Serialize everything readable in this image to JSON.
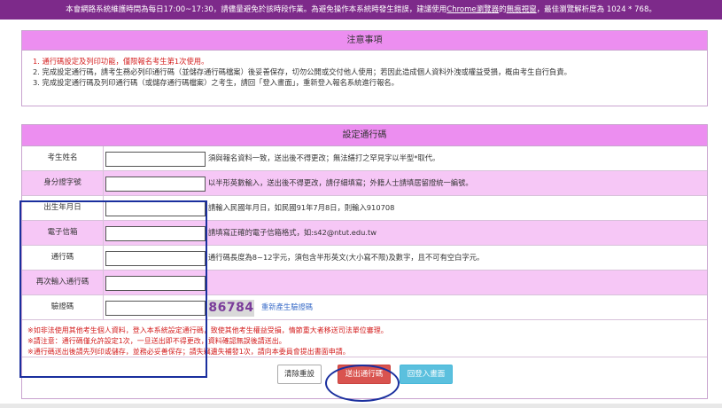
{
  "banner": {
    "text_before": "本會網路系統維護時間為每日17:00~17:30，請儘量避免於該時段作業。為避免操作本系統時發生錯誤，建議使用",
    "browser_link": "Chrome瀏覽器",
    "text_mid": "的",
    "incognito_link": "無痕視窗",
    "text_after": "，最佳瀏覽解析度為 1024 * 768。"
  },
  "notice": {
    "title": "注意事項",
    "item1": "1. 通行碼設定及列印功能，僅限報名考生第1次使用。",
    "item2": "2. 完成設定通行碼，請考生務必列印通行碼（並儲存通行碼檔案）後妥善保存，切勿公開或交付他人使用；若因此造成個人資料外洩或權益受損，概由考生自行負責。",
    "item3": "3. 完成設定通行碼及列印通行碼（或儲存通行碼檔案）之考生，請回「登入畫面」，重新登入報名系統進行報名。"
  },
  "form": {
    "title": "設定通行碼",
    "fields": {
      "name": {
        "label": "考生姓名",
        "value": "",
        "hint": "須與報名資料一致，送出後不得更改；無法繕打之罕見字以半型*取代。"
      },
      "id": {
        "label": "身分證字號",
        "value": "",
        "hint": "以半形英數輸入，送出後不得更改，請仔細填寫；外籍人士請填居留證統一編號。"
      },
      "birth": {
        "label": "出生年月日",
        "value": "",
        "hint": "請輸入民國年月日，如民國91年7月8日，則輸入910708"
      },
      "email": {
        "label": "電子信箱",
        "value": "",
        "hint": "請填寫正確的電子信箱格式，如:s42@ntut.edu.tw"
      },
      "pass": {
        "label": "通行碼",
        "value": "",
        "hint": "通行碼長度為8~12字元，須包含半形英文(大小寫不限)及數字，且不可有空白字元。"
      },
      "pass2": {
        "label": "再次輸入通行碼",
        "value": ""
      },
      "captcha": {
        "label": "驗證碼",
        "value": "",
        "code": "86784",
        "refresh": "重新產生驗證碼"
      }
    },
    "warnings": {
      "w1": "※如非法使用其他考生個人資料，登入本系統設定通行碼，致使其他考生權益受損，情節重大者移送司法單位審理。",
      "w2": "※請注意：通行碼僅允許設定1次，一旦送出即不得更改，資料確認無誤後請送出。",
      "w3": "※通行碼送出後請先列印或儲存，並務必妥善保存；請失竊遺失補發1次，請向本委員會提出書面申請。"
    },
    "buttons": {
      "clear": "清除重設",
      "send": "送出通行碼",
      "back": "回登入畫面"
    }
  },
  "colors": {
    "banner": "#7d2a8a",
    "header_pink": "#ec8ef0",
    "row_pink": "#f6c7f6",
    "warning_red": "#d42020",
    "annotation_blue": "#1a2f9e",
    "send_button": "#d9534f",
    "back_button": "#5bc0de"
  }
}
